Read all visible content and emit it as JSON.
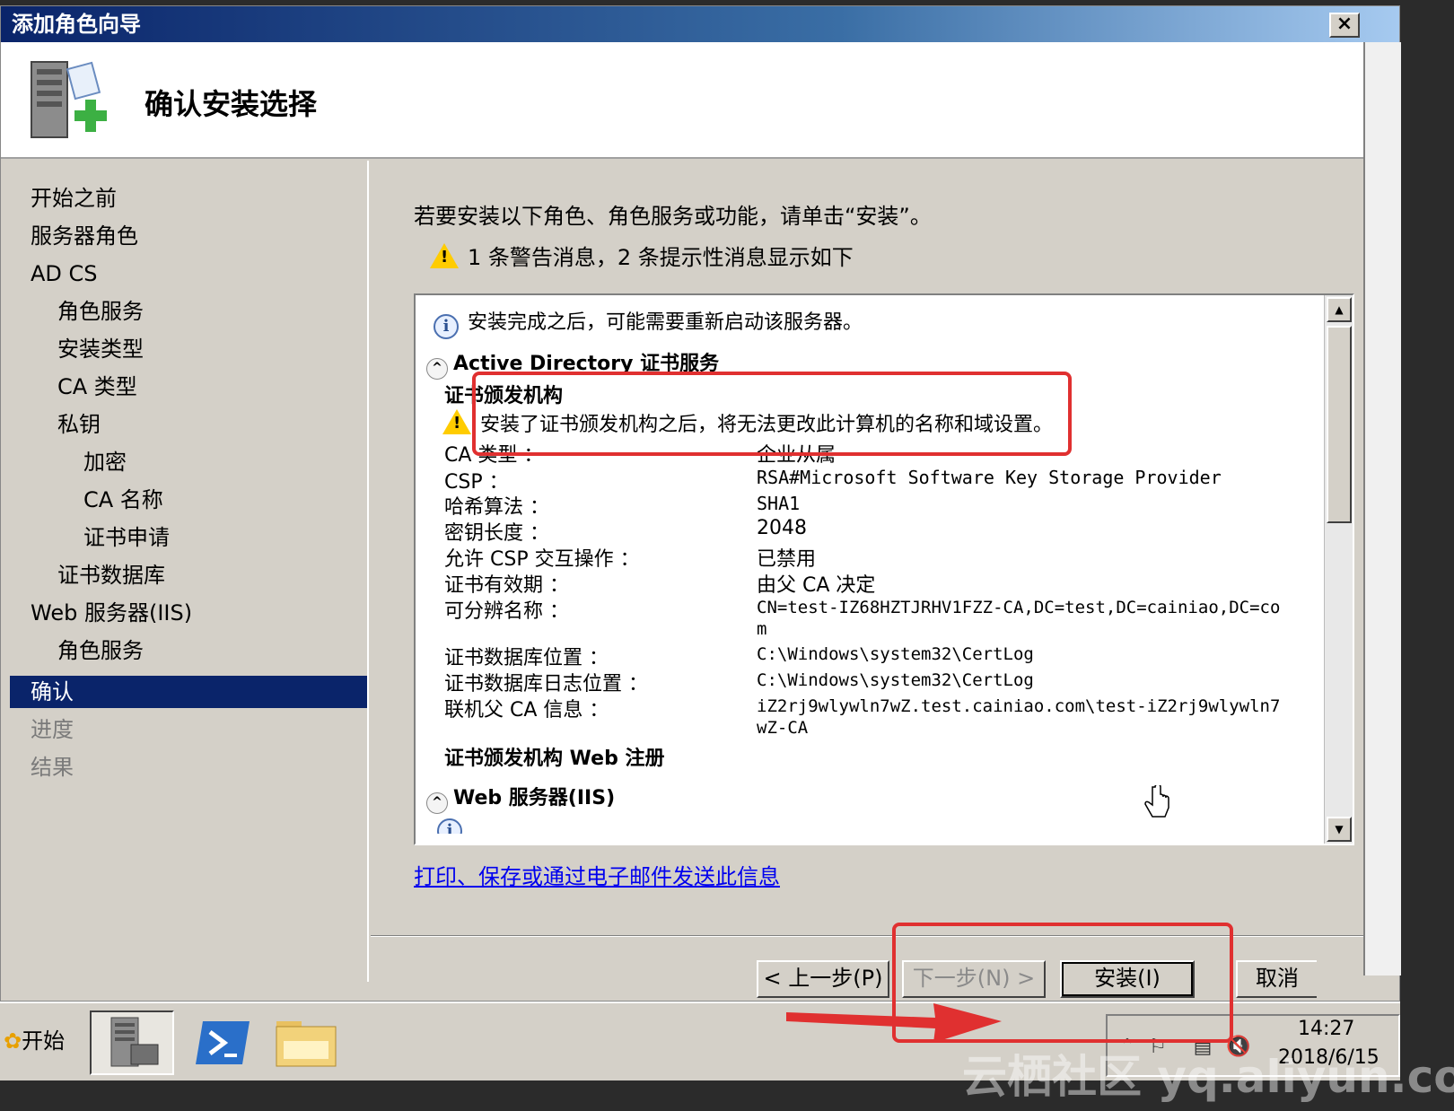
{
  "window": {
    "title": "添加角色向导",
    "close_glyph": "×"
  },
  "header": {
    "title": "确认安装选择"
  },
  "nav": {
    "items": [
      {
        "label": "开始之前"
      },
      {
        "label": "服务器角色"
      },
      {
        "label": "AD CS"
      },
      {
        "label": "角色服务"
      },
      {
        "label": "安装类型"
      },
      {
        "label": "CA 类型"
      },
      {
        "label": "私钥"
      },
      {
        "label": "加密"
      },
      {
        "label": "CA 名称"
      },
      {
        "label": "证书申请"
      },
      {
        "label": "证书数据库"
      },
      {
        "label": "Web 服务器(IIS)"
      },
      {
        "label": "角色服务"
      },
      {
        "label": "确认"
      },
      {
        "label": "进度"
      },
      {
        "label": "结果"
      }
    ]
  },
  "content": {
    "intro": "若要安装以下角色、角色服务或功能，请单击“安装”。",
    "warning_summary": "1 条警告消息，2 条提示性消息显示如下",
    "info_restart": "安装完成之后，可能需要重新启动该服务器。",
    "section_adcs": "Active Directory 证书服务",
    "subsection_ca": "证书颁发机构",
    "warning_ca": "安装了证书颁发机构之后，将无法更改此计算机的名称和域设置。",
    "properties": [
      {
        "label": "CA 类型 ：",
        "value": "企业从属"
      },
      {
        "label": "CSP ：",
        "value": "RSA#Microsoft Software Key Storage Provider"
      },
      {
        "label": "哈希算法 ：",
        "value": "SHA1"
      },
      {
        "label": "密钥长度 ：",
        "value": "2048"
      },
      {
        "label": "允许 CSP 交互操作 ：",
        "value": "已禁用"
      },
      {
        "label": "证书有效期 ：",
        "value": "由父 CA 决定"
      },
      {
        "label": "可分辨名称 ：",
        "value": "CN=test-IZ68HZTJRHV1FZZ-CA,DC=test,DC=cainiao,DC=co",
        "value2": "m"
      },
      {
        "label": "证书数据库位置 ：",
        "value": "C:\\Windows\\system32\\CertLog"
      },
      {
        "label": "证书数据库日志位置 ：",
        "value": "C:\\Windows\\system32\\CertLog"
      },
      {
        "label": "联机父 CA 信息 ：",
        "value": "iZ2rj9wlywln7wZ.test.cainiao.com\\test-iZ2rj9wlywln7",
        "value2": "wZ-CA"
      }
    ],
    "subsection_web": "证书颁发机构 Web 注册",
    "section_iis": "Web 服务器(IIS)",
    "print_link": "打印、保存或通过电子邮件发送此信息"
  },
  "buttons": {
    "back": "< 上一步(P)",
    "next": "下一步(N) >",
    "install": "安装(I)",
    "cancel": "取消"
  },
  "taskbar": {
    "start": "开始",
    "clock_time": "14:27",
    "clock_date": "2018/6/15"
  },
  "watermark": "云栖社区 yq.aliyun.com",
  "colors": {
    "title_gradient_start": "#0a246a",
    "selected_nav": "#0a246a",
    "annotation_red": "#e03030",
    "link": "#0000ee"
  }
}
